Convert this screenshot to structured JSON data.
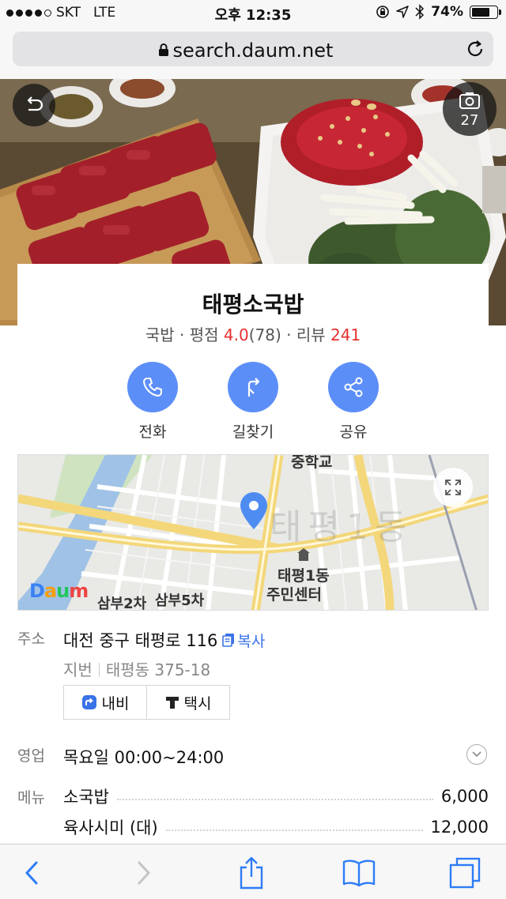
{
  "status_bar": {
    "carrier": "SKT",
    "network": "LTE",
    "time": "오후 12:35",
    "battery": "74%",
    "battery_level": 0.74,
    "signal_bars": 4
  },
  "browser": {
    "url": "search.daum.net"
  },
  "hero": {
    "photo_count": "27"
  },
  "place": {
    "name": "태평소국밥",
    "category": "국밥",
    "rating_label": "평점",
    "rating": "4.0",
    "rating_count": "(78)",
    "review_label": "리뷰",
    "review_count": "241",
    "separator": "·"
  },
  "actions": [
    {
      "label": "전화",
      "icon": "phone-icon"
    },
    {
      "label": "길찾기",
      "icon": "directions-icon"
    },
    {
      "label": "공유",
      "icon": "share-icon"
    }
  ],
  "map": {
    "logo": "Daum",
    "labels": {
      "school": "중학교",
      "area_watermark": "태평1동",
      "center_line1": "태평1동",
      "center_line2": "주민센터",
      "samboo2": "삼부2차",
      "samboo5": "삼부5차"
    }
  },
  "address": {
    "label": "주소",
    "value": "대전 중구 태평로 116",
    "copy_label": "복사",
    "lot_label": "지번",
    "lot_value": "태평동 375-18",
    "navi_label": "내비",
    "taxi_label": "택시"
  },
  "hours": {
    "label": "영업",
    "value": "목요일 00:00~24:00"
  },
  "menu": {
    "label": "메뉴",
    "items": [
      {
        "name": "소국밥",
        "price": "6,000"
      },
      {
        "name": "육사시미 (대)",
        "price": "12,000"
      }
    ]
  },
  "colors": {
    "accent": "#5c8ef8",
    "highlight": "#e5312f",
    "link": "#3a72e8"
  }
}
